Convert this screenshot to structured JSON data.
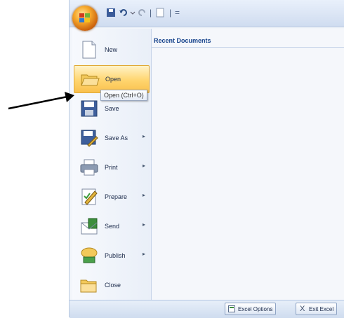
{
  "qat": {
    "separator": "|",
    "customize": "="
  },
  "recent": {
    "title": "Recent Documents"
  },
  "menu": {
    "items": [
      {
        "label": "New",
        "icon": "new-document-icon",
        "submenu": false
      },
      {
        "label": "Open",
        "icon": "open-folder-icon",
        "submenu": false,
        "highlighted": true
      },
      {
        "label": "Save",
        "icon": "save-disk-icon",
        "submenu": false
      },
      {
        "label": "Save As",
        "icon": "save-as-icon",
        "submenu": true
      },
      {
        "label": "Print",
        "icon": "printer-icon",
        "submenu": true
      },
      {
        "label": "Prepare",
        "icon": "prepare-icon",
        "submenu": true
      },
      {
        "label": "Send",
        "icon": "send-icon",
        "submenu": true
      },
      {
        "label": "Publish",
        "icon": "publish-icon",
        "submenu": true
      },
      {
        "label": "Close",
        "icon": "close-folder-icon",
        "submenu": false
      }
    ],
    "submenu_arrow": "▸"
  },
  "tooltip": {
    "text": "Open (Ctrl+O)"
  },
  "bottom": {
    "options_label": "Excel Options",
    "exit_label": "Exit Excel",
    "exit_glyph": "X"
  },
  "colors": {
    "highlight": "#ffd56e",
    "accent": "#15428b",
    "frame": "#dfe8f5"
  }
}
